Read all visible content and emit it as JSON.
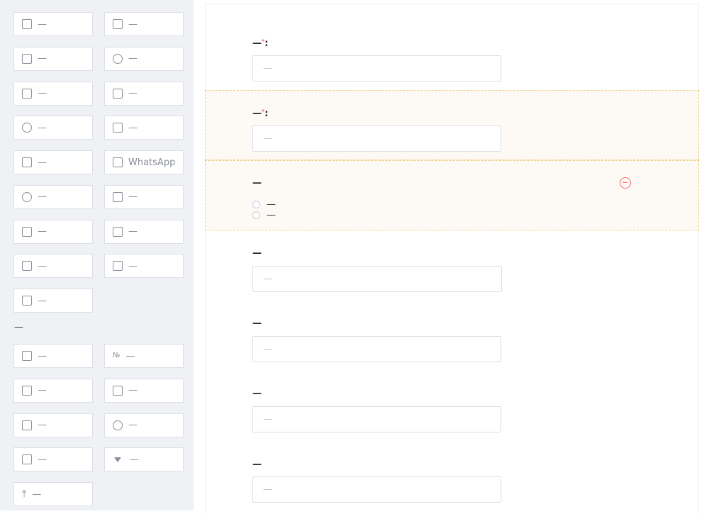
{
  "palette": {
    "contact_items": [
      {
        "icon": "user-icon",
        "label": "—"
      },
      {
        "icon": "male-icon",
        "label": "—"
      },
      {
        "icon": "cake-icon",
        "label": "—"
      },
      {
        "icon": "globe-icon",
        "label": "—"
      },
      {
        "icon": "mail-icon",
        "label": "—"
      },
      {
        "icon": "region-icon",
        "label": "—"
      },
      {
        "icon": "chat-icon",
        "label": "—"
      },
      {
        "icon": "flag-icon",
        "label": "—"
      },
      {
        "icon": "org-icon",
        "label": "—"
      },
      {
        "icon": "grid-icon",
        "label": "WhatsApp"
      },
      {
        "icon": "location-icon",
        "label": "—"
      },
      {
        "icon": "document-icon",
        "label": "—"
      },
      {
        "icon": "monitor-icon",
        "label": "—"
      },
      {
        "icon": "postcode-icon",
        "label": "—"
      },
      {
        "icon": "briefcase-icon",
        "label": "—"
      },
      {
        "icon": "columns-icon",
        "label": "—"
      },
      {
        "icon": "department-icon",
        "label": "—"
      }
    ],
    "basic_group_title": "—",
    "basic_items": [
      {
        "icon": "file-icon",
        "label": "—"
      },
      {
        "icon": "number-icon",
        "label": "—",
        "glyph": "№"
      },
      {
        "icon": "calendar-icon",
        "label": "—"
      },
      {
        "icon": "mail-icon",
        "label": "—"
      },
      {
        "icon": "textarea-icon",
        "label": "—"
      },
      {
        "icon": "radio-icon",
        "label": "—"
      },
      {
        "icon": "checkbox-icon",
        "label": "—"
      },
      {
        "icon": "dropdown-icon",
        "label": "—"
      },
      {
        "icon": "upload-icon",
        "label": "—",
        "glyph": "⤒"
      }
    ]
  },
  "form": {
    "phone": {
      "label": "—",
      "required_mark": "*",
      "suffix": ":",
      "placeholder": "—"
    },
    "email": {
      "label": "—",
      "required_mark": "*",
      "suffix": ":",
      "placeholder": "—"
    },
    "gender": {
      "label": "—",
      "options": [
        "—",
        "—"
      ]
    },
    "country": {
      "label": "—",
      "placeholder": "—"
    },
    "company": {
      "label": "—",
      "placeholder": "—"
    },
    "wechat": {
      "label": "—",
      "placeholder": "—"
    },
    "industry": {
      "label": "—",
      "placeholder": "—"
    }
  },
  "colors": {
    "sidebar_bg": "#f0f1f4",
    "selected_block_border": "#f3cd85",
    "selected_block_bg": "#fdfaf5",
    "danger": "#f56c6c"
  }
}
